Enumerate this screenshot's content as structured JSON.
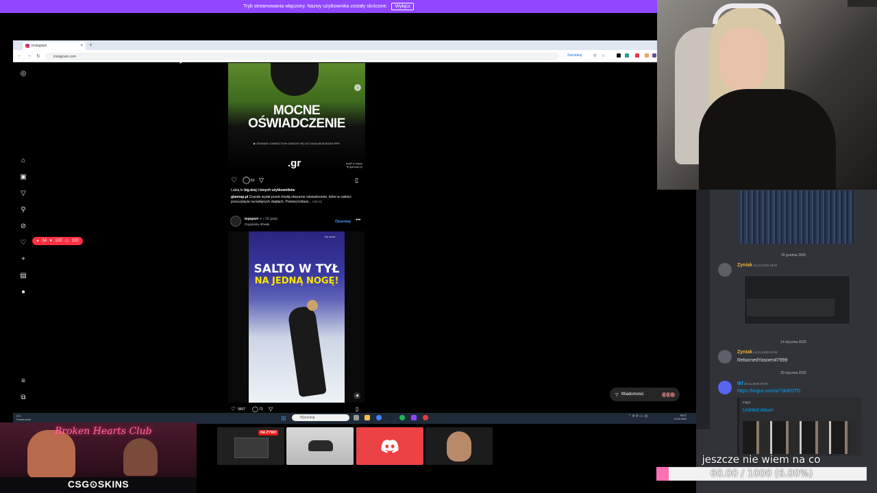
{
  "stream_banner": {
    "text": "Tryb streamowania włączony. Nazwy użytkownika zostały skrócone.",
    "button": "Wyłącz"
  },
  "browser": {
    "tab_title": "Instagram",
    "tab_close": "×",
    "new_tab": "+",
    "url": "instagram.com",
    "install_label": "Zainstaluj",
    "nav_back": "←",
    "nav_forward": "→",
    "nav_reload": "↻"
  },
  "instagram": {
    "sidebar_icons": [
      "instagram-logo",
      "home",
      "reels",
      "messages",
      "search",
      "explore",
      "notifications",
      "create",
      "dashboard",
      "profile",
      "menu",
      "meta"
    ],
    "notif_badge": {
      "comments": "34",
      "likes": "100",
      "follows": "100"
    },
    "post1": {
      "headline_line1": "MOCNE",
      "headline_line2": "OŚWIADCZENIE",
      "subtext": "▶ GRANDE CONNECTION ODNOSI SIĘ DO DZIAŁAŃ BONUSA RPK",
      "logo": ".gr",
      "corner_tag": "bądź w kręgu\n⊕ glamrap.pl",
      "comment_count": "52",
      "likes_text_prefix": "Lubią to ",
      "likes_user": "big.dzej",
      "likes_text_suffix": " i innych użytkowników",
      "caption_user": "glamrap.pl",
      "caption_text": " Grande wydał przed chwilą obszerne oświadczenie, które w całości przeczytacie na kolejnych slajdach. Poniżej krótsze...",
      "caption_more": " więcej"
    },
    "post2": {
      "account": "tvpsport",
      "time": " • 18 godz.",
      "audio": "Oryginalny dźwięk",
      "follow": "Obserwuj",
      "more": "•••",
      "headline_line1": "SALTO W TYŁ",
      "headline_line2": "NA JEDNĄ NOGĘ!",
      "video_tag": "tvp sport",
      "like_count": "9607",
      "comment_count": "73"
    },
    "messages_button": "Wiadomości"
  },
  "taskbar": {
    "weather": "3°C\nPochmurnie",
    "search_placeholder": "Wyszukaj",
    "clock_time": "05:27",
    "clock_date": "10.02.2026"
  },
  "discord": {
    "date1": "16 grudnia 2025",
    "msg1": {
      "user": "Zyniak",
      "time": " 16.12.2025 18:52"
    },
    "date2": "14 stycznia 2026",
    "msg2": {
      "user": "Zyniak",
      "time": " 14.01.2026 23:53",
      "text": "RebornedYasoen#7999"
    },
    "date3": "20 stycznia 2026",
    "msg3": {
      "user": "tkf",
      "time": " 20.01.2026 03:40",
      "link": "https://imgur.com/a/73kROTD"
    },
    "embed": {
      "provider": "Imgur",
      "title": "Untitled Album"
    }
  },
  "overlay": {
    "promo_title": "Broken Hearts Club",
    "promo_brand": "CSG⊙SKINS",
    "live_badge": "NA ŻYWO",
    "goal_text": "jeszcze nie wiem na co",
    "goal_progress": "60.00 / 1000 (6.00%)",
    "goal_fraction": 0.06
  },
  "colors": {
    "banner": "#9146ff",
    "ig_notif": "#ff3040",
    "discord_bg": "#313338",
    "discord_user": "#f0b232",
    "discord_link": "#00a8fc",
    "goal_fill": "#ff6fb3"
  }
}
